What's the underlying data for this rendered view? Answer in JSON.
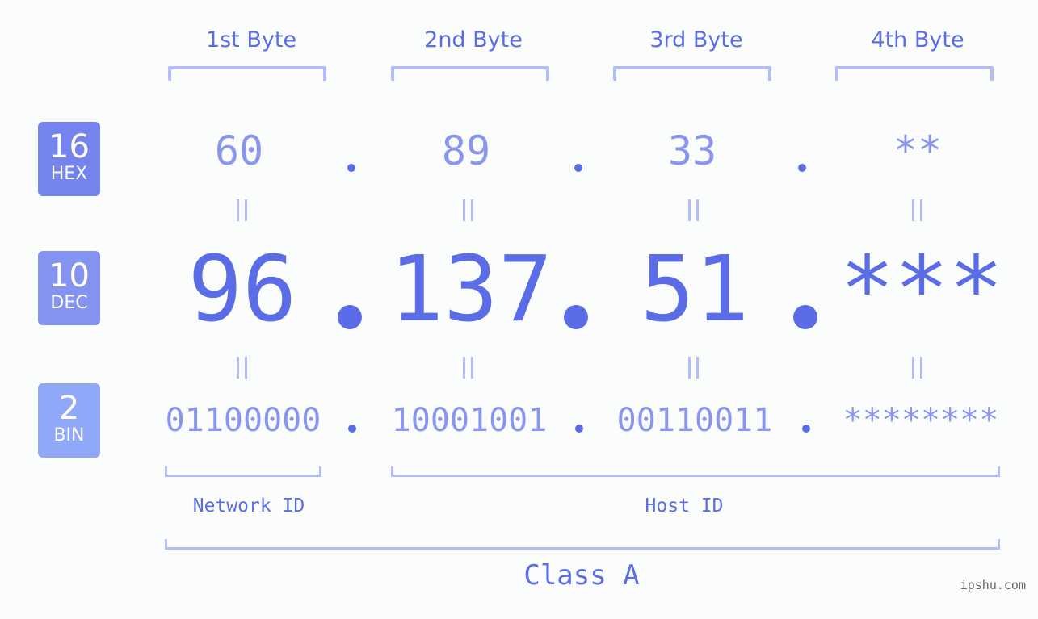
{
  "colors": {
    "background": "#fbfdfc",
    "accent": "#5a6de6",
    "light_value": "#8a95ee",
    "bracket": "#b3bcf6",
    "badge_hex": "#7584ec",
    "badge_dec": "#8593f0",
    "badge_bin": "#8fa8f8"
  },
  "bases": [
    {
      "num": "16",
      "label": "HEX"
    },
    {
      "num": "10",
      "label": "DEC"
    },
    {
      "num": "2",
      "label": "BIN"
    }
  ],
  "byte_headers": [
    "1st Byte",
    "2nd Byte",
    "3rd Byte",
    "4th Byte"
  ],
  "separator": ".",
  "hex_values": [
    "60",
    "89",
    "33",
    "**"
  ],
  "dec_values": [
    "96",
    "137",
    "51",
    "***"
  ],
  "bin_values": [
    "01100000",
    "10001001",
    "00110011",
    "********"
  ],
  "segments": {
    "network": "Network ID",
    "host": "Host ID"
  },
  "ip_class": "Class A",
  "watermark": "ipshu.com"
}
